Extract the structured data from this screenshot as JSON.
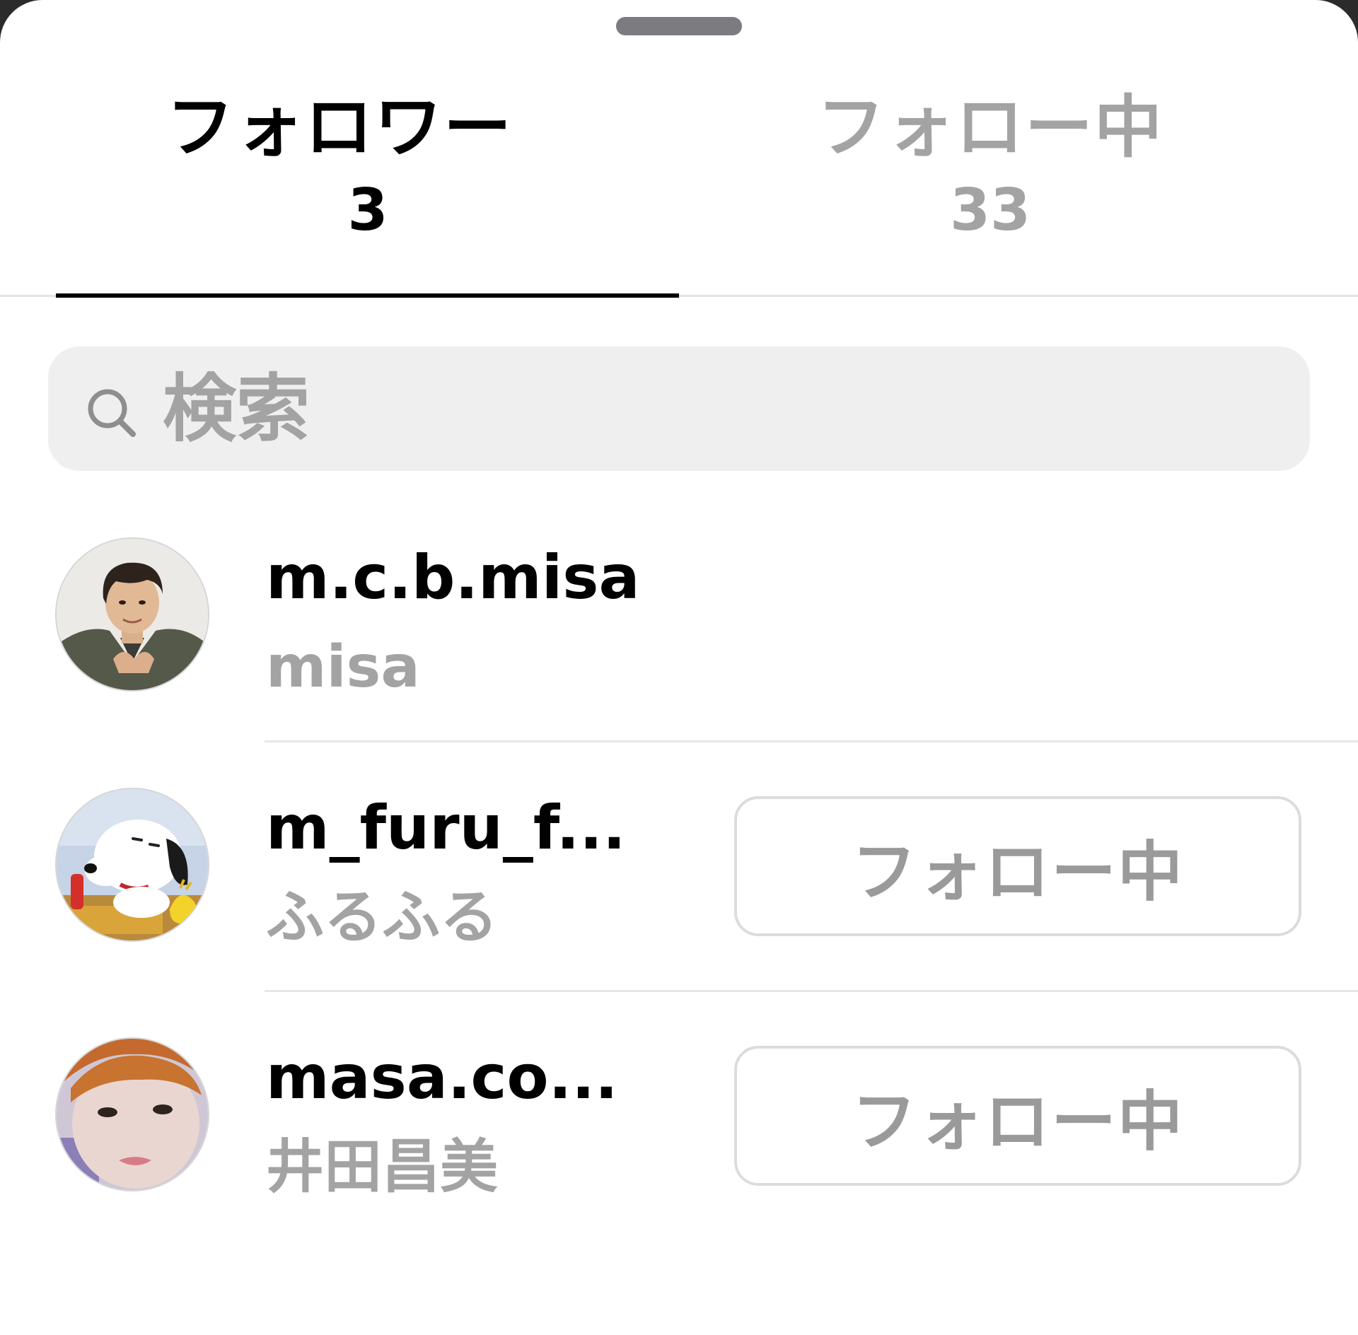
{
  "tabs": {
    "followers": {
      "label": "フォロワー",
      "count": "3",
      "active": true
    },
    "following": {
      "label": "フォロー中",
      "count": "33",
      "active": false
    }
  },
  "search": {
    "placeholder": "検索",
    "icon": "search-icon"
  },
  "users": [
    {
      "username": "m.c.b.misa",
      "fullname": "misa",
      "button_label": "",
      "avatar": "man-portrait-avatar"
    },
    {
      "username": "m_furu_f...",
      "fullname": "ふるふる",
      "button_label": "フォロー中",
      "avatar": "snoopy-avatar"
    },
    {
      "username": "masa.co...",
      "fullname": "井田昌美",
      "button_label": "フォロー中",
      "avatar": "woman-selfie-avatar"
    }
  ],
  "colors": {
    "active_text": "#000000",
    "inactive_text": "#a3a3a3",
    "search_background": "#efefef",
    "button_border": "#dcdcdc"
  }
}
